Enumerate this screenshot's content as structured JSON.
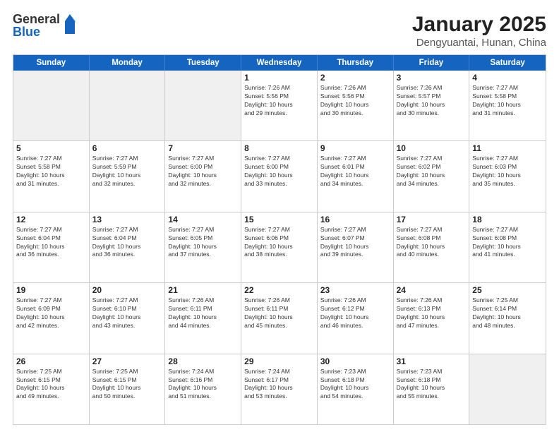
{
  "logo": {
    "general": "General",
    "blue": "Blue"
  },
  "header": {
    "month": "January 2025",
    "location": "Dengyuantai, Hunan, China"
  },
  "weekdays": [
    "Sunday",
    "Monday",
    "Tuesday",
    "Wednesday",
    "Thursday",
    "Friday",
    "Saturday"
  ],
  "rows": [
    [
      {
        "day": "",
        "info": "",
        "shaded": true
      },
      {
        "day": "",
        "info": "",
        "shaded": true
      },
      {
        "day": "",
        "info": "",
        "shaded": true
      },
      {
        "day": "1",
        "info": "Sunrise: 7:26 AM\nSunset: 5:56 PM\nDaylight: 10 hours\nand 29 minutes."
      },
      {
        "day": "2",
        "info": "Sunrise: 7:26 AM\nSunset: 5:56 PM\nDaylight: 10 hours\nand 30 minutes."
      },
      {
        "day": "3",
        "info": "Sunrise: 7:26 AM\nSunset: 5:57 PM\nDaylight: 10 hours\nand 30 minutes."
      },
      {
        "day": "4",
        "info": "Sunrise: 7:27 AM\nSunset: 5:58 PM\nDaylight: 10 hours\nand 31 minutes."
      }
    ],
    [
      {
        "day": "5",
        "info": "Sunrise: 7:27 AM\nSunset: 5:58 PM\nDaylight: 10 hours\nand 31 minutes."
      },
      {
        "day": "6",
        "info": "Sunrise: 7:27 AM\nSunset: 5:59 PM\nDaylight: 10 hours\nand 32 minutes."
      },
      {
        "day": "7",
        "info": "Sunrise: 7:27 AM\nSunset: 6:00 PM\nDaylight: 10 hours\nand 32 minutes."
      },
      {
        "day": "8",
        "info": "Sunrise: 7:27 AM\nSunset: 6:00 PM\nDaylight: 10 hours\nand 33 minutes."
      },
      {
        "day": "9",
        "info": "Sunrise: 7:27 AM\nSunset: 6:01 PM\nDaylight: 10 hours\nand 34 minutes."
      },
      {
        "day": "10",
        "info": "Sunrise: 7:27 AM\nSunset: 6:02 PM\nDaylight: 10 hours\nand 34 minutes."
      },
      {
        "day": "11",
        "info": "Sunrise: 7:27 AM\nSunset: 6:03 PM\nDaylight: 10 hours\nand 35 minutes."
      }
    ],
    [
      {
        "day": "12",
        "info": "Sunrise: 7:27 AM\nSunset: 6:04 PM\nDaylight: 10 hours\nand 36 minutes."
      },
      {
        "day": "13",
        "info": "Sunrise: 7:27 AM\nSunset: 6:04 PM\nDaylight: 10 hours\nand 36 minutes."
      },
      {
        "day": "14",
        "info": "Sunrise: 7:27 AM\nSunset: 6:05 PM\nDaylight: 10 hours\nand 37 minutes."
      },
      {
        "day": "15",
        "info": "Sunrise: 7:27 AM\nSunset: 6:06 PM\nDaylight: 10 hours\nand 38 minutes."
      },
      {
        "day": "16",
        "info": "Sunrise: 7:27 AM\nSunset: 6:07 PM\nDaylight: 10 hours\nand 39 minutes."
      },
      {
        "day": "17",
        "info": "Sunrise: 7:27 AM\nSunset: 6:08 PM\nDaylight: 10 hours\nand 40 minutes."
      },
      {
        "day": "18",
        "info": "Sunrise: 7:27 AM\nSunset: 6:08 PM\nDaylight: 10 hours\nand 41 minutes."
      }
    ],
    [
      {
        "day": "19",
        "info": "Sunrise: 7:27 AM\nSunset: 6:09 PM\nDaylight: 10 hours\nand 42 minutes."
      },
      {
        "day": "20",
        "info": "Sunrise: 7:27 AM\nSunset: 6:10 PM\nDaylight: 10 hours\nand 43 minutes."
      },
      {
        "day": "21",
        "info": "Sunrise: 7:26 AM\nSunset: 6:11 PM\nDaylight: 10 hours\nand 44 minutes."
      },
      {
        "day": "22",
        "info": "Sunrise: 7:26 AM\nSunset: 6:11 PM\nDaylight: 10 hours\nand 45 minutes."
      },
      {
        "day": "23",
        "info": "Sunrise: 7:26 AM\nSunset: 6:12 PM\nDaylight: 10 hours\nand 46 minutes."
      },
      {
        "day": "24",
        "info": "Sunrise: 7:26 AM\nSunset: 6:13 PM\nDaylight: 10 hours\nand 47 minutes."
      },
      {
        "day": "25",
        "info": "Sunrise: 7:25 AM\nSunset: 6:14 PM\nDaylight: 10 hours\nand 48 minutes."
      }
    ],
    [
      {
        "day": "26",
        "info": "Sunrise: 7:25 AM\nSunset: 6:15 PM\nDaylight: 10 hours\nand 49 minutes."
      },
      {
        "day": "27",
        "info": "Sunrise: 7:25 AM\nSunset: 6:15 PM\nDaylight: 10 hours\nand 50 minutes."
      },
      {
        "day": "28",
        "info": "Sunrise: 7:24 AM\nSunset: 6:16 PM\nDaylight: 10 hours\nand 51 minutes."
      },
      {
        "day": "29",
        "info": "Sunrise: 7:24 AM\nSunset: 6:17 PM\nDaylight: 10 hours\nand 53 minutes."
      },
      {
        "day": "30",
        "info": "Sunrise: 7:23 AM\nSunset: 6:18 PM\nDaylight: 10 hours\nand 54 minutes."
      },
      {
        "day": "31",
        "info": "Sunrise: 7:23 AM\nSunset: 6:18 PM\nDaylight: 10 hours\nand 55 minutes."
      },
      {
        "day": "",
        "info": "",
        "shaded": true
      }
    ]
  ]
}
